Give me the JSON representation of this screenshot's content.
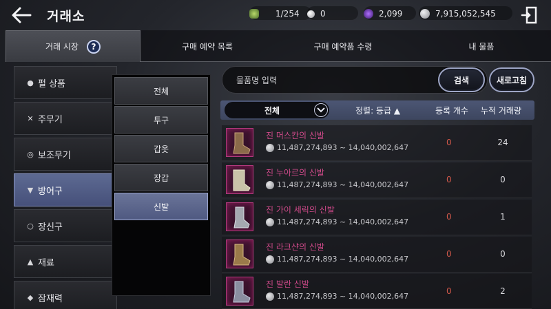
{
  "header": {
    "title": "거래소",
    "inventory": "1/254",
    "pearls": "0",
    "energy": "2,099",
    "silver": "7,915,052,545"
  },
  "tabs": [
    {
      "label": "거래 시장",
      "active": true
    },
    {
      "label": "구매 예약 목록"
    },
    {
      "label": "구매 예약품 수령"
    },
    {
      "label": "내 물품"
    }
  ],
  "help_icon_text": "?",
  "categories": [
    {
      "label": "펄 상품",
      "icon": "pearl-icon"
    },
    {
      "label": "주무기",
      "icon": "swords-icon"
    },
    {
      "label": "보조무기",
      "icon": "ring-target-icon"
    },
    {
      "label": "방어구",
      "icon": "armor-icon",
      "active": true
    },
    {
      "label": "장신구",
      "icon": "ring-icon"
    },
    {
      "label": "재료",
      "icon": "flask-icon"
    },
    {
      "label": "잠재력",
      "icon": "diamond-icon"
    }
  ],
  "subcategories": [
    {
      "label": "전체"
    },
    {
      "label": "투구"
    },
    {
      "label": "갑옷"
    },
    {
      "label": "장갑"
    },
    {
      "label": "신발",
      "active": true
    }
  ],
  "search": {
    "placeholder": "물품명 입력",
    "search_label": "검색",
    "refresh_label": "새로고침"
  },
  "table": {
    "filter_label": "전체",
    "sort_label": "정렬: 등급 ▲",
    "col_registered": "등록 개수",
    "col_volume": "누적 거래량",
    "rows": [
      {
        "name": "진 머스칸의 신발",
        "price": "11,487,274,893 ~ 14,040,002,647",
        "registered": "0",
        "volume": "24"
      },
      {
        "name": "진 누아르의 신발",
        "price": "11,487,274,893 ~ 14,040,002,647",
        "registered": "0",
        "volume": "0"
      },
      {
        "name": "진 가이 세릭의 신발",
        "price": "11,487,274,893 ~ 14,040,002,647",
        "registered": "0",
        "volume": "1"
      },
      {
        "name": "진 라크샨의 신발",
        "price": "11,487,274,893 ~ 14,040,002,647",
        "registered": "0",
        "volume": "0"
      },
      {
        "name": "진 발란 신발",
        "price": "11,487,274,893 ~ 14,040,002,647",
        "registered": "0",
        "volume": "2"
      }
    ]
  },
  "colors": {
    "accent": "#5d6a92",
    "item_name": "#d04a8a",
    "registered_zero": "#d2584a"
  }
}
